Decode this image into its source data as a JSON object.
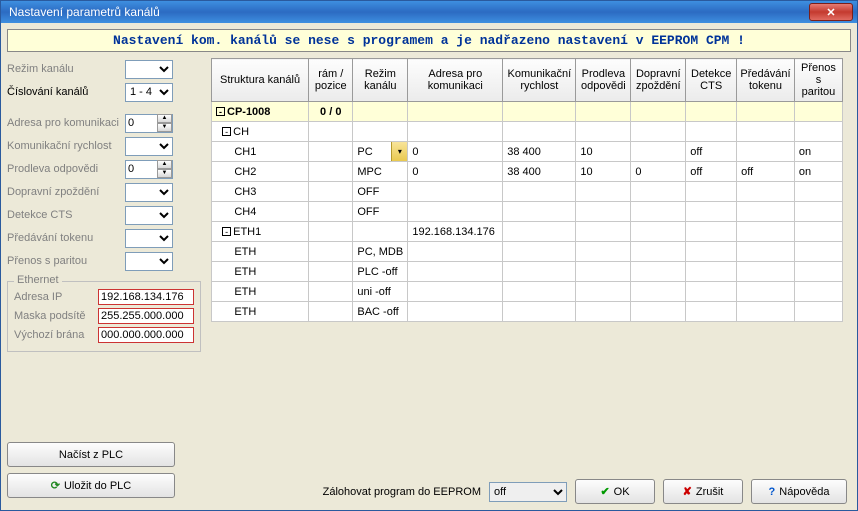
{
  "window": {
    "title": "Nastavení parametrů kanálů"
  },
  "banner": "Nastavení kom. kanálů se nese s programem a je nadřazeno nastavení v EEPROM CPM !",
  "left": {
    "rezim_kanalu": "Režim kanálu",
    "cislovani_kanalu": "Číslování kanálů",
    "cislovani_value": "1 - 4",
    "adresa": "Adresa pro komunikaci",
    "adresa_value": "0",
    "rychlost": "Komunikační rychlost",
    "prodleva": "Prodleva odpovědi",
    "prodleva_value": "0",
    "zpozdeni": "Dopravní zpoždění",
    "cts": "Detekce CTS",
    "token": "Předávání tokenu",
    "parita": "Přenos s paritou",
    "ethernet": {
      "title": "Ethernet",
      "adresa_ip_label": "Adresa IP",
      "adresa_ip": "192.168.134.176",
      "maska_label": "Maska podsítě",
      "maska": "255.255.000.000",
      "brana_label": "Výchozí brána",
      "brana": "000.000.000.000"
    },
    "nacist": "Načíst z PLC",
    "ulozit": "Uložit do PLC"
  },
  "grid": {
    "headers": {
      "struktura": "Struktura kanálů",
      "ram": "rám / pozice",
      "rezim": "Režim kanálu",
      "adresa": "Adresa pro komunikaci",
      "rychlost": "Komunikační rychlost",
      "prodleva": "Prodleva odpovědi",
      "zpozdeni": "Dopravní zpoždění",
      "cts": "Detekce CTS",
      "token": "Předávání tokenu",
      "parita": "Přenos s paritou"
    },
    "rows": [
      {
        "tree": "CP-1008",
        "indent": 0,
        "box": "-",
        "ram": "0 / 0",
        "rezim": "",
        "adresa": "",
        "rychlost": "",
        "prodleva": "",
        "zpozdeni": "",
        "cts": "",
        "token": "",
        "parita": "",
        "root": true
      },
      {
        "tree": "CH",
        "indent": 1,
        "box": "-",
        "ram": "",
        "rezim": "",
        "adresa": "",
        "rychlost": "",
        "prodleva": "",
        "zpozdeni": "",
        "cts": "",
        "token": "",
        "parita": ""
      },
      {
        "tree": "CH1",
        "indent": 2,
        "box": "",
        "ram": "",
        "rezim": "PC",
        "rezim_dd": true,
        "adresa": "0",
        "rychlost": "38 400",
        "prodleva": "10",
        "zpozdeni": "",
        "cts": "off",
        "token": "",
        "parita": "on"
      },
      {
        "tree": "CH2",
        "indent": 2,
        "box": "",
        "ram": "",
        "rezim": "MPC",
        "adresa": "0",
        "rychlost": "38 400",
        "prodleva": "10",
        "zpozdeni": "0",
        "cts": "off",
        "token": "off",
        "parita": "on"
      },
      {
        "tree": "CH3",
        "indent": 2,
        "box": "",
        "ram": "",
        "rezim": "OFF",
        "adresa": "",
        "rychlost": "",
        "prodleva": "",
        "zpozdeni": "",
        "cts": "",
        "token": "",
        "parita": ""
      },
      {
        "tree": "CH4",
        "indent": 2,
        "box": "",
        "ram": "",
        "rezim": "OFF",
        "adresa": "",
        "rychlost": "",
        "prodleva": "",
        "zpozdeni": "",
        "cts": "",
        "token": "",
        "parita": ""
      },
      {
        "tree": "ETH1",
        "indent": 1,
        "box": "-",
        "ram": "",
        "rezim": "",
        "adresa": "192.168.134.176",
        "rychlost": "",
        "prodleva": "",
        "zpozdeni": "",
        "cts": "",
        "token": "",
        "parita": ""
      },
      {
        "tree": "ETH",
        "indent": 2,
        "box": "",
        "ram": "",
        "rezim": "PC, MDB",
        "adresa": "",
        "rychlost": "",
        "prodleva": "",
        "zpozdeni": "",
        "cts": "",
        "token": "",
        "parita": ""
      },
      {
        "tree": "ETH",
        "indent": 2,
        "box": "",
        "ram": "",
        "rezim": "PLC -off",
        "adresa": "",
        "rychlost": "",
        "prodleva": "",
        "zpozdeni": "",
        "cts": "",
        "token": "",
        "parita": ""
      },
      {
        "tree": "ETH",
        "indent": 2,
        "box": "",
        "ram": "",
        "rezim": "uni -off",
        "adresa": "",
        "rychlost": "",
        "prodleva": "",
        "zpozdeni": "",
        "cts": "",
        "token": "",
        "parita": ""
      },
      {
        "tree": "ETH",
        "indent": 2,
        "box": "",
        "ram": "",
        "rezim": "BAC -off",
        "adresa": "",
        "rychlost": "",
        "prodleva": "",
        "zpozdeni": "",
        "cts": "",
        "token": "",
        "parita": ""
      }
    ]
  },
  "bottom": {
    "zalohovat": "Zálohovat program do EEPROM",
    "eeprom_value": "off",
    "ok": "OK",
    "zrusit": "Zrušit",
    "napoveda": "Nápověda"
  }
}
